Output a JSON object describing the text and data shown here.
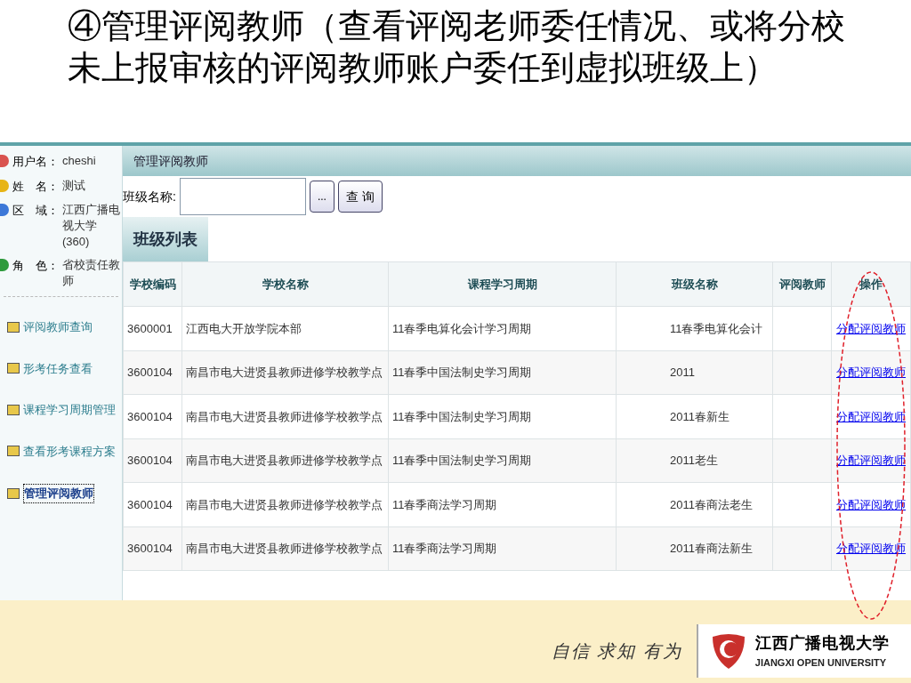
{
  "slide": {
    "title": "④管理评阅教师（查看评阅老师委任情况、或将分校未上报审核的评阅教师账户委任到虚拟班级上）"
  },
  "screenshot": {
    "sidebar": {
      "user_info": [
        {
          "label": "用户名：",
          "value": "cheshi"
        },
        {
          "label": "姓　名：",
          "value": "测试"
        },
        {
          "label": "区　域：",
          "value": "江西广播电视大学(360)"
        },
        {
          "label": "角　色：",
          "value": "省校责任教师"
        }
      ],
      "menu": [
        {
          "label": "评阅教师查询",
          "selected": false
        },
        {
          "label": "形考任务查看",
          "selected": false
        },
        {
          "label": "课程学习周期管理",
          "selected": false
        },
        {
          "label": "查看形考课程方案",
          "selected": false
        },
        {
          "label": "管理评阅教师",
          "selected": true
        }
      ]
    },
    "panel_title": "管理评阅教师",
    "search": {
      "label": "班级名称:",
      "browse_button": "...",
      "query_button": "查 询"
    },
    "list_tab": "班级列表",
    "table": {
      "columns": [
        "学校编码",
        "学校名称",
        "课程学习周期",
        "班级名称",
        "评阅教师",
        "操作"
      ],
      "rows": [
        {
          "cells": [
            "3600001",
            "江西电大开放学院本部",
            "11春季电算化会计学习周期",
            "11春季电算化会计",
            ""
          ],
          "action": "分配评阅教师"
        },
        {
          "cells": [
            "3600104",
            "南昌市电大进贤县教师进修学校教学点",
            "11春季中国法制史学习周期",
            "2011",
            ""
          ],
          "action": "分配评阅教师"
        },
        {
          "cells": [
            "3600104",
            "南昌市电大进贤县教师进修学校教学点",
            "11春季中国法制史学习周期",
            "2011春新生",
            ""
          ],
          "action": "分配评阅教师"
        },
        {
          "cells": [
            "3600104",
            "南昌市电大进贤县教师进修学校教学点",
            "11春季中国法制史学习周期",
            "2011老生",
            ""
          ],
          "action": "分配评阅教师"
        },
        {
          "cells": [
            "3600104",
            "南昌市电大进贤县教师进修学校教学点",
            "11春季商法学习周期",
            "2011春商法老生",
            ""
          ],
          "action": "分配评阅教师"
        },
        {
          "cells": [
            "3600104",
            "南昌市电大进贤县教师进修学校教学点",
            "11春季商法学习周期",
            "2011春商法新生",
            ""
          ],
          "action": "分配评阅教师"
        }
      ]
    }
  },
  "footer": {
    "motto": "自信 求知 有为",
    "logo_name": "江西广播电视大学",
    "logo_subtitle": "JIANGXI OPEN UNIVERSITY"
  }
}
